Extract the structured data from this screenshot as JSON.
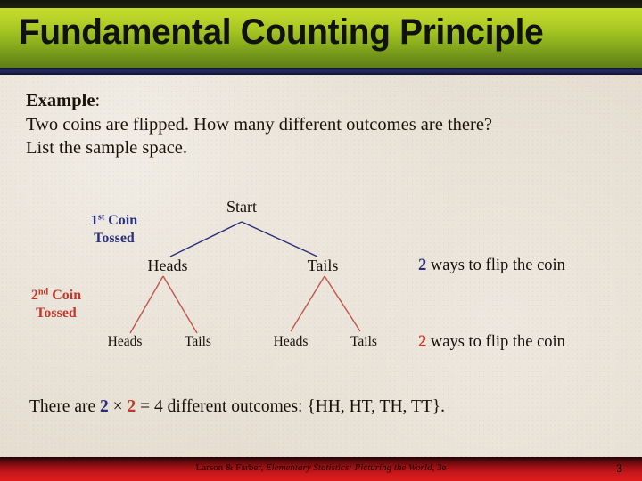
{
  "slide": {
    "title": "Fundamental Counting Principle",
    "example": {
      "lead": "Example",
      "lead_colon": ":",
      "line1": "Two coins are flipped.  How many different outcomes are there?",
      "line2": "List the sample space."
    },
    "tree": {
      "root": "Start",
      "level1_label": {
        "num": "1",
        "sup": "st",
        "word": " Coin",
        "line2": "Tossed"
      },
      "level2_label": {
        "num": "2",
        "sup": "nd",
        "word": " Coin",
        "line2": "Tossed"
      },
      "level1_nodes": [
        "Heads",
        "Tails"
      ],
      "level2_nodes": [
        "Heads",
        "Tails",
        "Heads",
        "Tails"
      ],
      "ways_first": {
        "count": "2",
        "text": " ways to flip the coin"
      },
      "ways_second": {
        "count": "2",
        "text": " ways to flip the coin"
      }
    },
    "conclusion": {
      "pre": "There are ",
      "factor1": "2",
      "times": " × ",
      "factor2": "2",
      "post": " = 4 different outcomes: {HH, HT, TH, TT}."
    },
    "footer": {
      "authors": "Larson & Farber, ",
      "book": "Elementary Statistics: Picturing the World",
      "edition": ", 3e",
      "page": "3"
    },
    "colors": {
      "title_band_top": "#c6dc2e",
      "title_band_bottom": "#5f7f18",
      "navy_rule": "#262a63",
      "blue_accent": "#2b2f7a",
      "red_accent": "#c0392b",
      "footer_red": "#e01d1d",
      "background": "#e5ddd0"
    }
  }
}
